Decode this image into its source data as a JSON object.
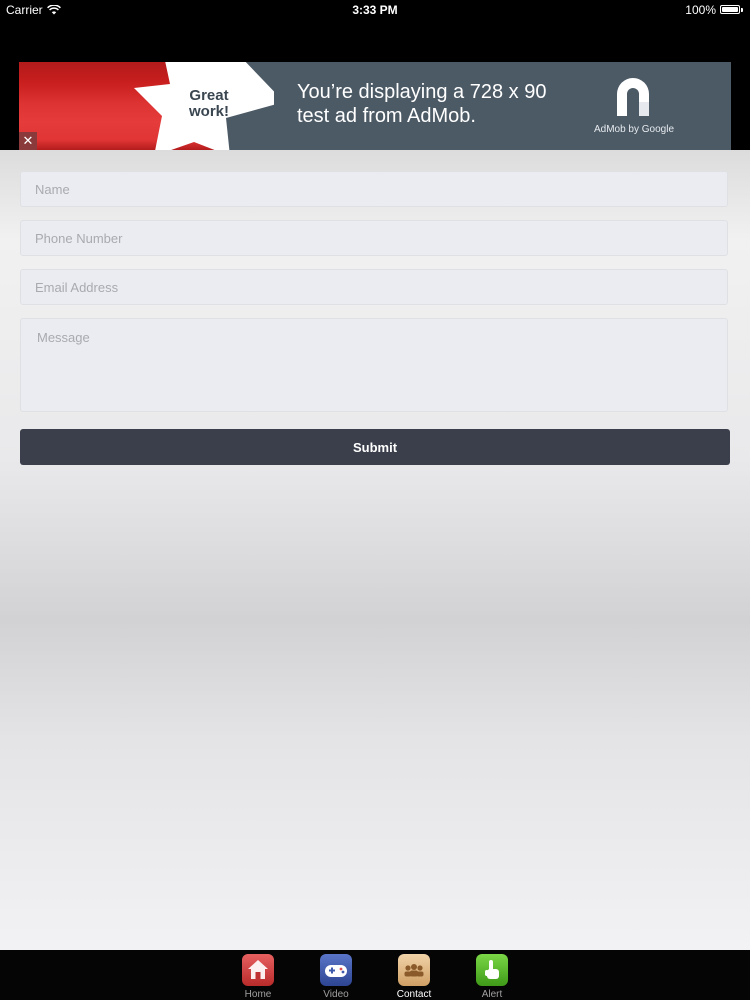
{
  "status_bar": {
    "carrier": "Carrier",
    "time": "3:33 PM",
    "battery": "100%",
    "battery_level": 1.0
  },
  "ad": {
    "badge_text": "Great work!",
    "message": "You’re displaying a 728 x 90 test ad from AdMob.",
    "brand_caption": "AdMob by Google",
    "close_glyph": "✕",
    "colors": {
      "background": "#4c5a66",
      "stripe_red": "#d42a2a",
      "star": "#ffffff"
    }
  },
  "form": {
    "name": {
      "placeholder": "Name",
      "value": ""
    },
    "phone": {
      "placeholder": "Phone Number",
      "value": ""
    },
    "email": {
      "placeholder": "Email Address",
      "value": ""
    },
    "message": {
      "placeholder": "Message",
      "value": ""
    },
    "submit_label": "Submit",
    "colors": {
      "field_background": "#ebecf1",
      "button_background": "#3a3f4b"
    }
  },
  "tab_bar": {
    "active": "Contact",
    "tabs": [
      {
        "label": "Home",
        "icon": "home-icon",
        "color": "#d94141"
      },
      {
        "label": "Video",
        "icon": "gamepad-icon",
        "color": "#3f5aab"
      },
      {
        "label": "Contact",
        "icon": "contacts-icon",
        "color": "#e2b985"
      },
      {
        "label": "Alert",
        "icon": "pointer-hand-icon",
        "color": "#5cbf2e"
      }
    ]
  }
}
